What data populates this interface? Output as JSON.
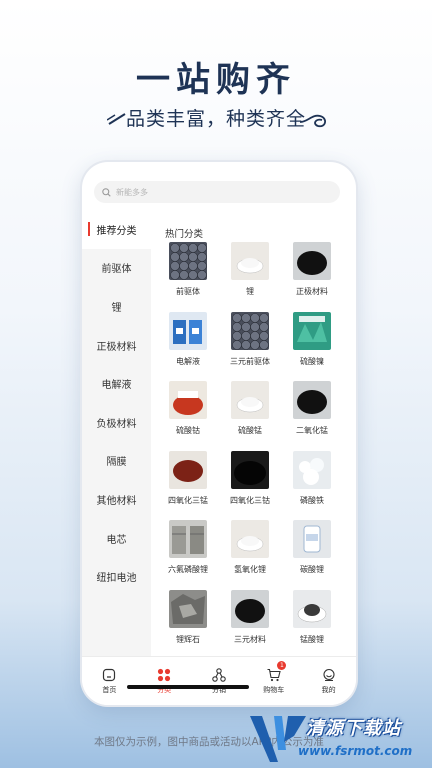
{
  "headline": "一站购齐",
  "subline": "品类丰富，种类齐全",
  "search": {
    "placeholder": "新能多多"
  },
  "sidebar": {
    "items": [
      {
        "label": "推荐分类",
        "active": true
      },
      {
        "label": "前驱体"
      },
      {
        "label": "锂"
      },
      {
        "label": "正极材料"
      },
      {
        "label": "电解液"
      },
      {
        "label": "负极材料"
      },
      {
        "label": "隔膜"
      },
      {
        "label": "其他材料"
      },
      {
        "label": "电芯"
      },
      {
        "label": "纽扣电池"
      }
    ]
  },
  "section_title": "热门分类",
  "products": [
    {
      "label": "前驱体",
      "thumb": "grey-spheres"
    },
    {
      "label": "锂",
      "thumb": "white-powder-dish"
    },
    {
      "label": "正极材料",
      "thumb": "black-powder-dish"
    },
    {
      "label": "电解液",
      "thumb": "blue-barrels"
    },
    {
      "label": "三元前驱体",
      "thumb": "grey-spheres"
    },
    {
      "label": "硫酸镍",
      "thumb": "green-crystals"
    },
    {
      "label": "硫酸钴",
      "thumb": "red-powder-bag"
    },
    {
      "label": "硫酸锰",
      "thumb": "white-powder-dish"
    },
    {
      "label": "二氧化锰",
      "thumb": "black-powder-dish"
    },
    {
      "label": "四氧化三锰",
      "thumb": "brown-powder-dish"
    },
    {
      "label": "四氧化三钴",
      "thumb": "black-powder"
    },
    {
      "label": "磷酸铁",
      "thumb": "white-crystals"
    },
    {
      "label": "六氟磷酸锂",
      "thumb": "steel-drums"
    },
    {
      "label": "氢氧化锂",
      "thumb": "white-powder-dish"
    },
    {
      "label": "碳酸锂",
      "thumb": "white-powder-bottle"
    },
    {
      "label": "锂辉石",
      "thumb": "grey-rock"
    },
    {
      "label": "三元材料",
      "thumb": "black-powder-dish"
    },
    {
      "label": "锰酸锂",
      "thumb": "grey-powder-dish"
    }
  ],
  "tabbar": {
    "tabs": [
      {
        "label": "首页",
        "icon": "home-icon"
      },
      {
        "label": "分类",
        "icon": "category-icon",
        "active": true
      },
      {
        "label": "分销",
        "icon": "distribution-icon"
      },
      {
        "label": "购物车",
        "icon": "cart-icon",
        "badge": "1"
      },
      {
        "label": "我的",
        "icon": "profile-icon"
      }
    ]
  },
  "disclaimer": "本图仅为示例，图中商品或活动以APP内公示为准",
  "watermark": {
    "title": "清源下载站",
    "url": "www.fsrmot.com"
  },
  "colors": {
    "accent": "#e83a2f",
    "headline": "#1e3355"
  }
}
